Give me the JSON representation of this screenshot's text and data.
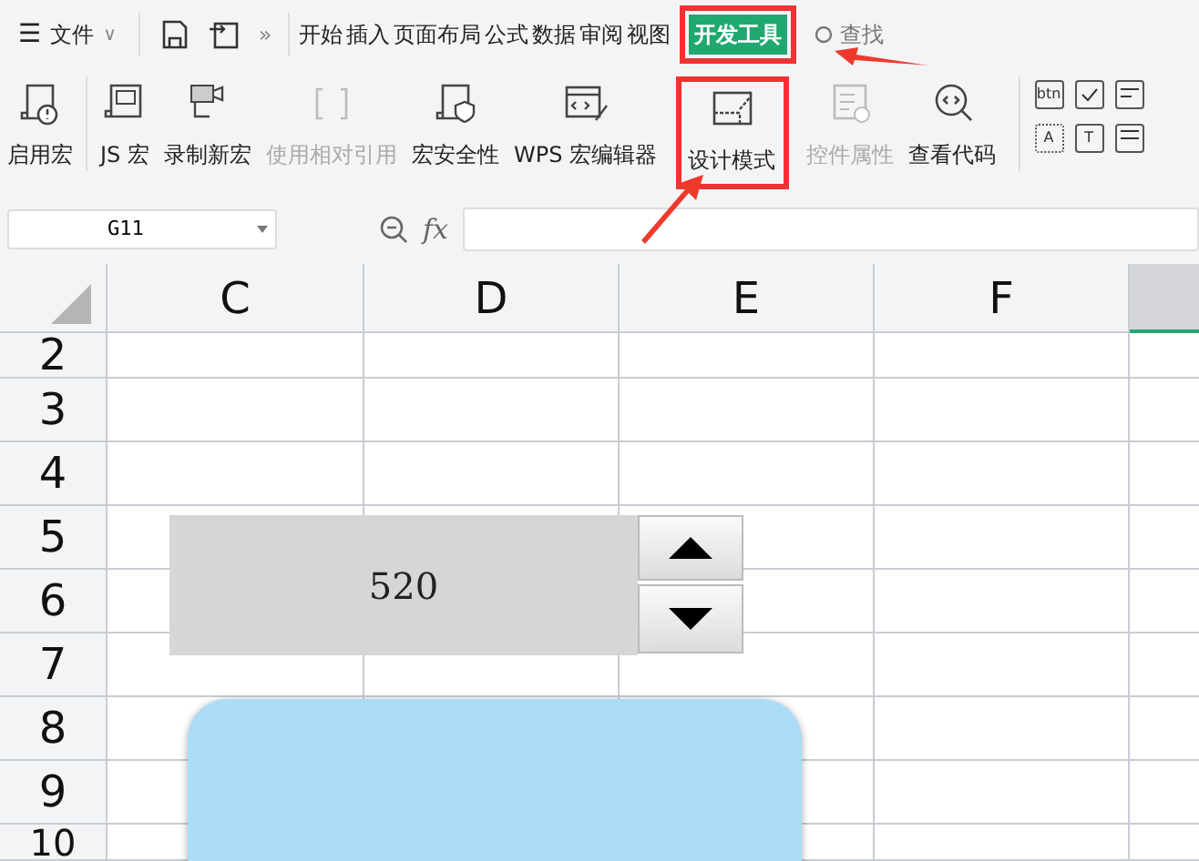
{
  "menu": {
    "icon": "☰",
    "file": "文件",
    "caret": "∨"
  },
  "quick_more": "»",
  "tabs": [
    {
      "label": "开始",
      "selected": false,
      "highlighted": false
    },
    {
      "label": "插入",
      "selected": false,
      "highlighted": false
    },
    {
      "label": "页面布局",
      "selected": false,
      "highlighted": false
    },
    {
      "label": "公式",
      "selected": false,
      "highlighted": false
    },
    {
      "label": "数据",
      "selected": false,
      "highlighted": false
    },
    {
      "label": "审阅",
      "selected": false,
      "highlighted": false
    },
    {
      "label": "视图",
      "selected": false,
      "highlighted": false
    },
    {
      "label": "开发工具",
      "selected": true,
      "highlighted": true
    }
  ],
  "search": {
    "label": "查找"
  },
  "ribbon": [
    {
      "kind": "macro",
      "label": "启用宏",
      "disabled": false,
      "highlighted": false
    },
    {
      "kind": "js",
      "label": "JS 宏",
      "disabled": false,
      "highlighted": false
    },
    {
      "kind": "record",
      "label": "录制新宏",
      "disabled": false,
      "highlighted": false
    },
    {
      "kind": "relative",
      "label": "使用相对引用",
      "disabled": true,
      "highlighted": false
    },
    {
      "kind": "security",
      "label": "宏安全性",
      "disabled": false,
      "highlighted": false
    },
    {
      "kind": "editor",
      "label": "WPS 宏编辑器",
      "disabled": false,
      "highlighted": false
    },
    {
      "kind": "design",
      "label": "设计模式",
      "disabled": false,
      "highlighted": true
    },
    {
      "kind": "properties",
      "label": "控件属性",
      "disabled": true,
      "highlighted": false
    },
    {
      "kind": "code",
      "label": "查看代码",
      "disabled": false,
      "highlighted": false
    }
  ],
  "controls": [
    "btn",
    "A",
    "T"
  ],
  "name_box": "G11",
  "formula_fx": "fx",
  "columns": [
    "C",
    "D",
    "E",
    "F"
  ],
  "rows": [
    "2",
    "3",
    "4",
    "5",
    "6",
    "7",
    "8",
    "9",
    "10"
  ],
  "spin_value": "520"
}
